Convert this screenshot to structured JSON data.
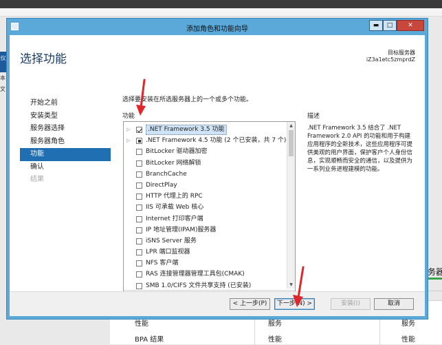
{
  "window": {
    "title": "添加角色和功能向导",
    "buttons": {
      "minimize": "▬",
      "maximize": "□",
      "close": "✕"
    }
  },
  "header": {
    "page_title": "选择功能",
    "destination_label": "目标服务器",
    "destination_server": "iZ3a1etc5zmprdZ"
  },
  "nav": {
    "items": [
      {
        "label": "开始之前",
        "state": "normal"
      },
      {
        "label": "安装类型",
        "state": "normal"
      },
      {
        "label": "服务器选择",
        "state": "normal"
      },
      {
        "label": "服务器角色",
        "state": "normal"
      },
      {
        "label": "功能",
        "state": "active"
      },
      {
        "label": "确认",
        "state": "normal"
      },
      {
        "label": "结果",
        "state": "disabled"
      }
    ]
  },
  "main": {
    "instruction": "选择要安装在所选服务器上的一个或多个功能。",
    "features_label": "功能",
    "features": [
      {
        "label": ".NET Framework 3.5 功能",
        "expandable": true,
        "state": "checked",
        "selected": true
      },
      {
        "label": ".NET Framework 4.5 功能 (2 个已安装，共 7 个)",
        "expandable": true,
        "state": "partial",
        "selected": false
      },
      {
        "label": "BitLocker 驱动器加密",
        "expandable": false,
        "state": "unchecked",
        "selected": false
      },
      {
        "label": "BitLocker 网络解锁",
        "expandable": false,
        "state": "unchecked",
        "selected": false
      },
      {
        "label": "BranchCache",
        "expandable": false,
        "state": "unchecked",
        "selected": false
      },
      {
        "label": "DirectPlay",
        "expandable": false,
        "state": "unchecked",
        "selected": false
      },
      {
        "label": "HTTP 代理上的 RPC",
        "expandable": false,
        "state": "unchecked",
        "selected": false
      },
      {
        "label": "IIS 可承载 Web 核心",
        "expandable": false,
        "state": "unchecked",
        "selected": false
      },
      {
        "label": "Internet 打印客户端",
        "expandable": false,
        "state": "unchecked",
        "selected": false
      },
      {
        "label": "IP 地址管理(IPAM)服务器",
        "expandable": false,
        "state": "unchecked",
        "selected": false
      },
      {
        "label": "iSNS Server 服务",
        "expandable": false,
        "state": "unchecked",
        "selected": false
      },
      {
        "label": "LPR 端口监视器",
        "expandable": false,
        "state": "unchecked",
        "selected": false
      },
      {
        "label": "NFS 客户端",
        "expandable": false,
        "state": "unchecked",
        "selected": false
      },
      {
        "label": "RAS 连接管理器管理工具包(CMAK)",
        "expandable": false,
        "state": "unchecked",
        "selected": false
      },
      {
        "label": "SMB 1.0/CIFS 文件共享支持 (已安装)",
        "expandable": false,
        "state": "unchecked",
        "selected": false
      }
    ],
    "description_label": "描述",
    "description_text": ".NET Framework 3.5 结合了 .NET Framework 2.0 API 的功能和用于构建应用程序的全新技术，这些应用程序可提供美观的用户界面，保护客户个人身份信息，实现顺畅而安全的通信，以及提供为一系列业务进程建模的功能。"
  },
  "buttons": {
    "previous": "< 上一步(P)",
    "next": "下一步(N) >",
    "install": "安装(I)",
    "cancel": "取消"
  },
  "background": {
    "left_labels": [
      "仪",
      "本",
      "文"
    ],
    "right_panel_label": "务器",
    "table": {
      "row1": [
        "性能",
        "服务",
        "服务"
      ],
      "row2": [
        "BPA 结果",
        "性能",
        "性能"
      ]
    }
  },
  "colors": {
    "title_bar": "#5aa9d9",
    "nav_active": "#1f6fb2",
    "annotation_arrow": "#e0262b"
  },
  "icons": [
    "window-app-icon",
    "expand-arrow-icon",
    "checkbox-icon",
    "scroll-arrow-icon"
  ]
}
